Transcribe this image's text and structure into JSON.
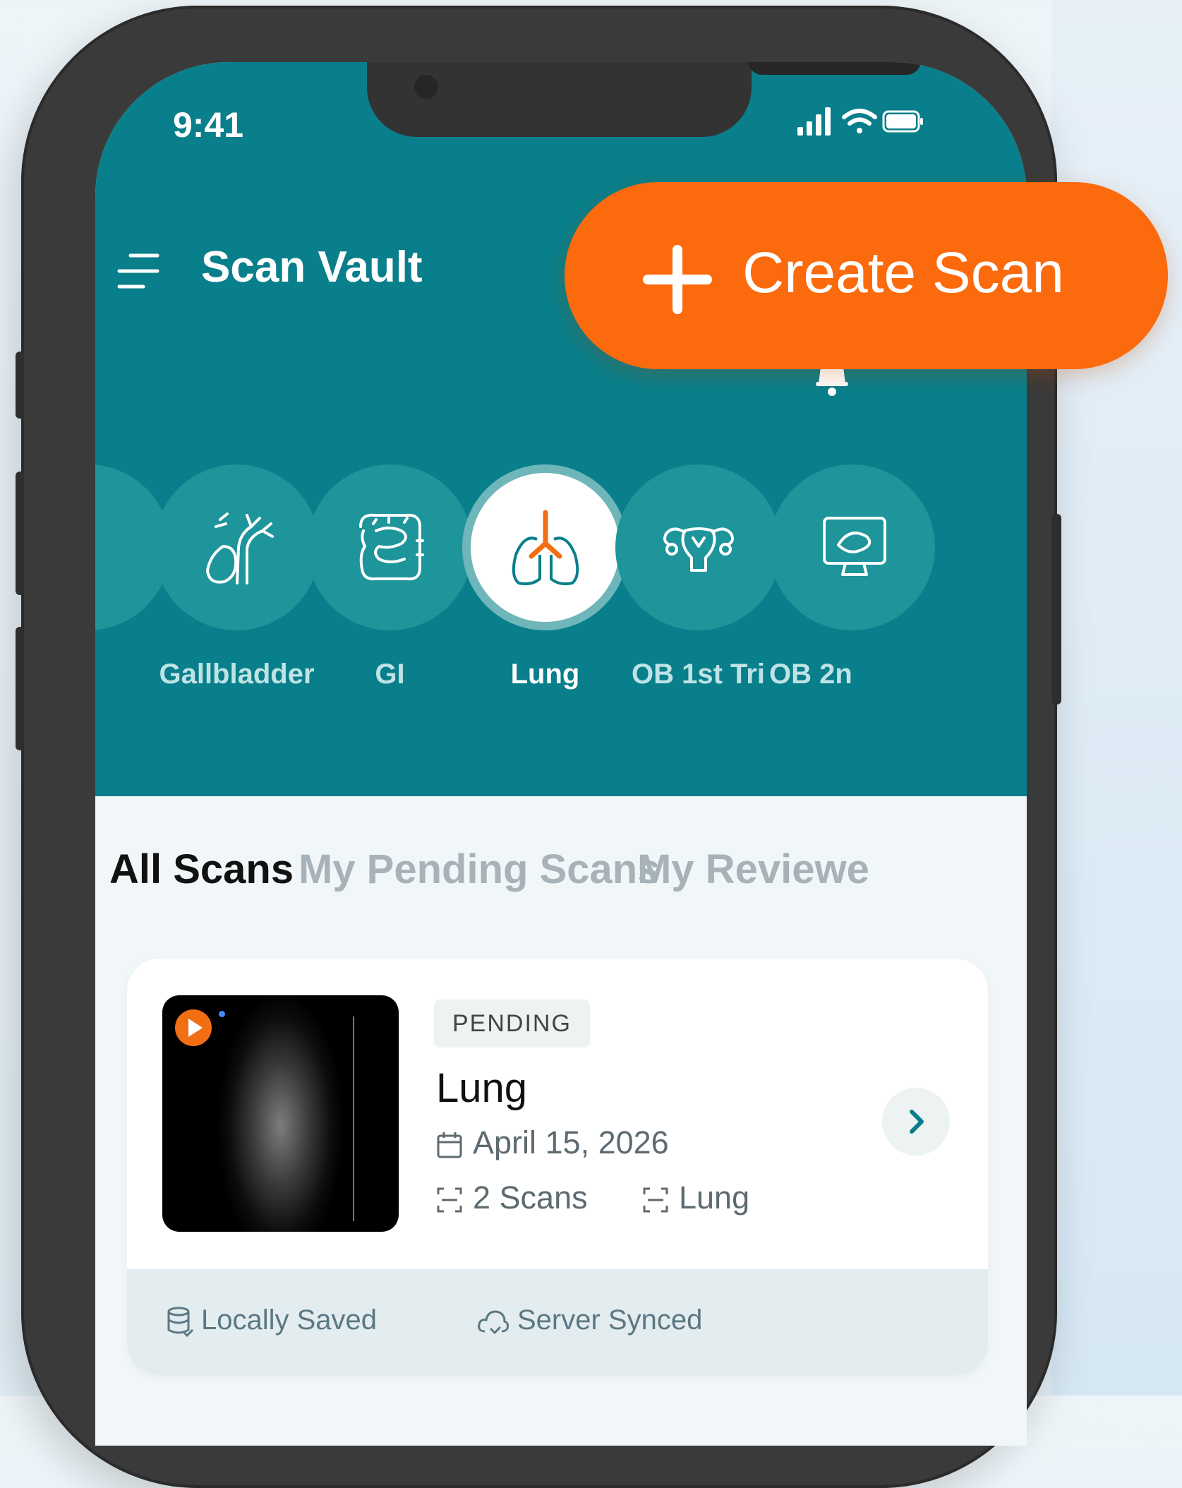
{
  "status_bar": {
    "time": "9:41"
  },
  "header": {
    "title": "Scan Vault"
  },
  "create_button": {
    "label": "Create Scan"
  },
  "categories": [
    {
      "label": "Gallbladder",
      "icon": "gallbladder-icon",
      "active": false
    },
    {
      "label": "GI",
      "icon": "intestine-icon",
      "active": false
    },
    {
      "label": "Lung",
      "icon": "lung-icon",
      "active": true
    },
    {
      "label": "OB 1st Tri",
      "icon": "uterus-icon",
      "active": false
    },
    {
      "label": "OB 2n",
      "icon": "monitor-icon",
      "active": false
    }
  ],
  "tabs": [
    {
      "label": "All Scans",
      "active": true
    },
    {
      "label": "My Pending Scans",
      "active": false
    },
    {
      "label": "My Reviewe",
      "active": false
    }
  ],
  "scan_card": {
    "badge": "PENDING",
    "title": "Lung",
    "date": "April 15, 2026",
    "scan_count": "2 Scans",
    "exam_type": "Lung",
    "footer": {
      "local": "Locally Saved",
      "server": "Server Synced"
    }
  },
  "colors": {
    "header_teal": "#087f8a",
    "accent_orange": "#fb6a0d",
    "circle_teal": "#1e949b"
  }
}
